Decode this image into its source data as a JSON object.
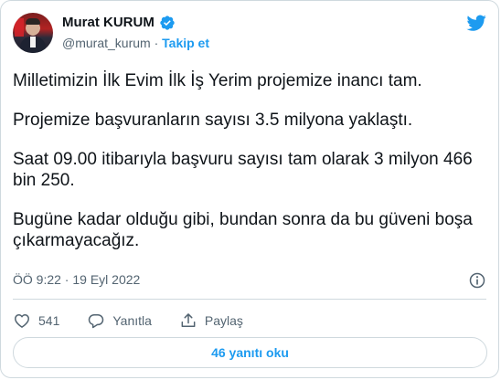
{
  "author": {
    "name": "Murat KURUM",
    "handle": "@murat_kurum",
    "separator": "·",
    "follow_label": "Takip et",
    "verified_icon": "verified-badge-icon"
  },
  "brand_icon": "twitter-bird-icon",
  "tweet": {
    "paragraphs": [
      "Milletimizin İlk Evim İlk İş Yerim projemize inancı tam.",
      "Projemize başvuranların sayısı 3.5 milyona yaklaştı.",
      "Saat 09.00 itibarıyla başvuru sayısı tam olarak 3 milyon 466 bin 250.",
      "Bugüne kadar olduğu gibi, bundan sonra da bu güveni boşa çıkarmayacağız."
    ],
    "timestamp": "ÖÖ 9:22 · 19 Eyl 2022"
  },
  "actions": {
    "like_count": "541",
    "reply_label": "Yanıtla",
    "share_label": "Paylaş"
  },
  "replies_button": "46 yanıtı oku",
  "colors": {
    "accent": "#1d9bf0",
    "text": "#0f1419",
    "secondary_text": "#536471",
    "border": "#cfd9de"
  }
}
